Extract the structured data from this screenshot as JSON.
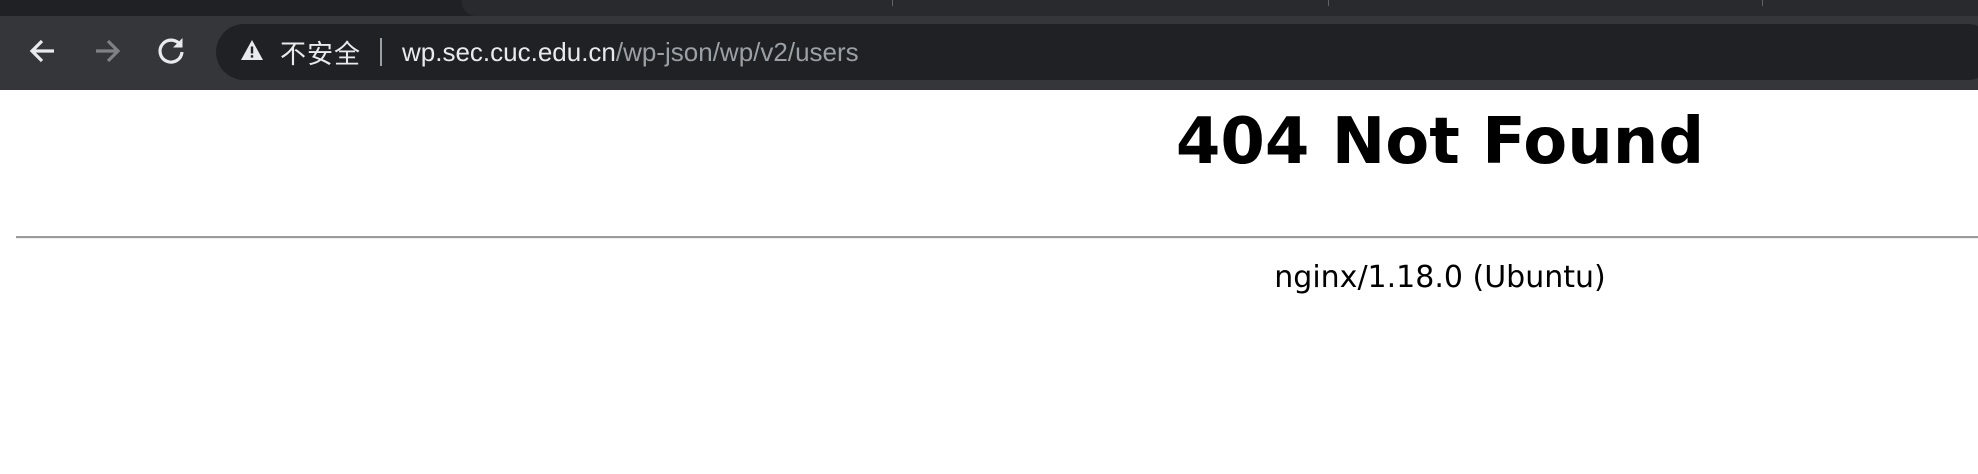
{
  "browser": {
    "security_label": "不安全",
    "url_host": "wp.sec.cuc.edu.cn",
    "url_path": "/wp-json/wp/v2/users",
    "icons": {
      "back": "arrow-left-icon",
      "forward": "arrow-right-icon",
      "reload": "reload-icon",
      "security": "warning-triangle-icon"
    }
  },
  "page": {
    "heading": "404 Not Found",
    "server_signature": "nginx/1.18.0 (Ubuntu)"
  }
}
